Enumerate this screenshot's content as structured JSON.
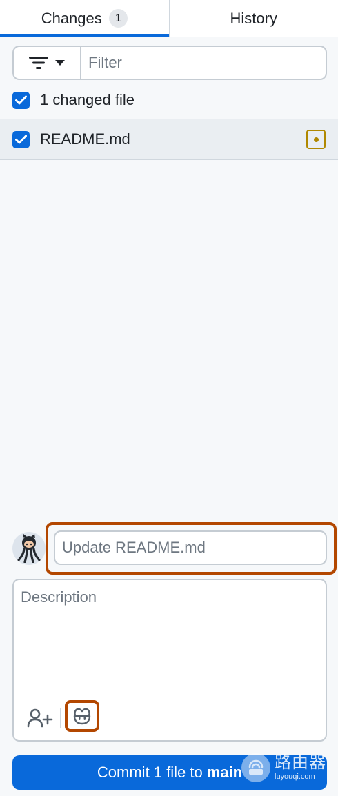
{
  "tabs": {
    "changes": {
      "label": "Changes",
      "count": "1"
    },
    "history": {
      "label": "History"
    }
  },
  "filter": {
    "placeholder": "Filter",
    "value": ""
  },
  "changes_summary": {
    "label": "1 changed file",
    "checked": true
  },
  "files": [
    {
      "name": "README.md",
      "checked": true,
      "status": "modified"
    }
  ],
  "commit": {
    "summary_placeholder": "Update README.md",
    "summary_value": "",
    "description_placeholder": "Description",
    "button_prefix": "Commit 1 file to",
    "branch": "main"
  },
  "watermark": {
    "cn": "路由器",
    "en": "luyouqi.com"
  },
  "colors": {
    "accent": "#0969da",
    "highlight": "#b34700",
    "modified": "#b08800"
  },
  "icons": {
    "filter": "filter-icon",
    "checkbox": "checkbox-checked-icon",
    "modified": "file-modified-icon",
    "avatar": "octocat-avatar",
    "coauthor": "add-person-icon",
    "copilot": "copilot-icon"
  }
}
